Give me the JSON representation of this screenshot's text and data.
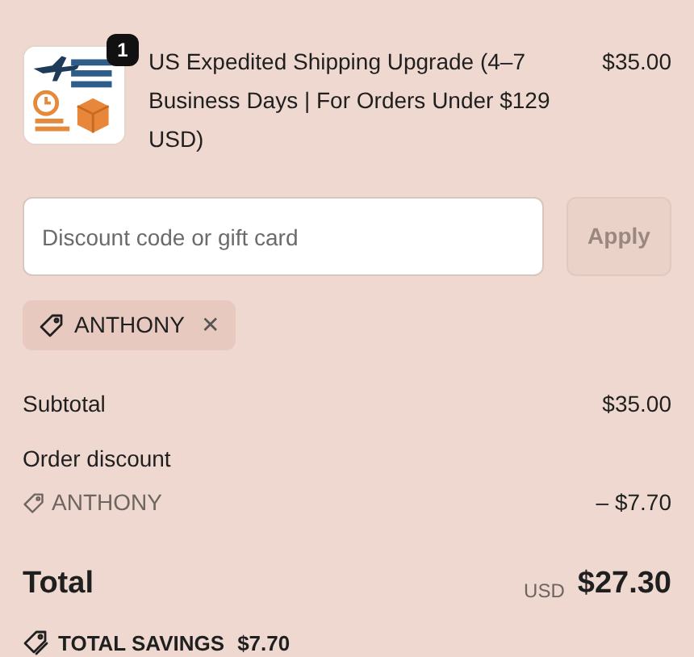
{
  "line_items": [
    {
      "kind": "picture",
      "quantity": "1",
      "title": "US Expedited Shipping Upgrade (4–7 Business Days | For Orders Under $129 USD)",
      "price": "$35.00"
    }
  ],
  "discount_field": {
    "placeholder": "Discount code or gift card"
  },
  "apply_button": {
    "label": "Apply",
    "disabled": true
  },
  "applied_codes": [
    {
      "code": "ANTHONY",
      "remove": "✕"
    }
  ],
  "summary": {
    "subtotal_label": "Subtotal",
    "subtotal": "$35.00",
    "discount_label": "Order discount",
    "discount_code": "ANTHONY",
    "discount_amount": "– $7.70",
    "total_label": "Total",
    "currency": "USD",
    "total": "$27.30",
    "savings_label": "TOTAL SAVINGS",
    "savings": "$7.70"
  }
}
